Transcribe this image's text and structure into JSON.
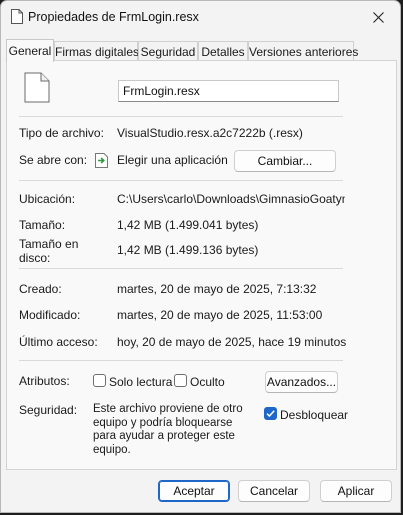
{
  "window": {
    "title": "Propiedades de FrmLogin.resx",
    "close_icon": "close-icon",
    "title_icon": "file-icon"
  },
  "tabs": [
    {
      "label": "General",
      "active": true
    },
    {
      "label": "Firmas digitales",
      "active": false
    },
    {
      "label": "Seguridad",
      "active": false
    },
    {
      "label": "Detalles",
      "active": false
    },
    {
      "label": "Versiones anteriores",
      "active": false
    }
  ],
  "general": {
    "file_icon": "document-icon",
    "filename": "FrmLogin.resx",
    "file_type_label": "Tipo de archivo:",
    "file_type_value": "VisualStudio.resx.a2c7222b (.resx)",
    "opens_with_label": "Se abre con:",
    "opens_with_value": "Elegir una aplicación",
    "opens_with_icon": "app-picker-icon",
    "change_button": "Cambiar...",
    "location_label": "Ubicación:",
    "location_value": "C:\\Users\\carlo\\Downloads\\GimnasioGoatym-m",
    "size_label": "Tamaño:",
    "size_value": "1,42 MB (1.499.041 bytes)",
    "size_on_disk_label": "Tamaño en disco:",
    "size_on_disk_value": "1,42 MB (1.499.136 bytes)",
    "created_label": "Creado:",
    "created_value": "martes, 20 de mayo de 2025, 7:13:32",
    "modified_label": "Modificado:",
    "modified_value": "martes, 20 de mayo de 2025, 11:53:00",
    "accessed_label": "Último acceso:",
    "accessed_value": "hoy, 20 de mayo de 2025, hace 19 minutos",
    "attributes_label": "Atributos:",
    "readonly_label": "Solo lectura",
    "readonly_checked": false,
    "hidden_label": "Oculto",
    "hidden_checked": false,
    "advanced_button": "Avanzados...",
    "security_label": "Seguridad:",
    "security_text": "Este archivo proviene de otro equipo y podría bloquearse para ayudar a proteger este equipo.",
    "unblock_label": "Desbloquear",
    "unblock_checked": true
  },
  "footer": {
    "ok": "Aceptar",
    "cancel": "Cancelar",
    "apply": "Aplicar"
  },
  "colors": {
    "accent": "#1e66c8",
    "window_bg": "#f3f3f3",
    "panel_bg": "#f9f9f9"
  }
}
